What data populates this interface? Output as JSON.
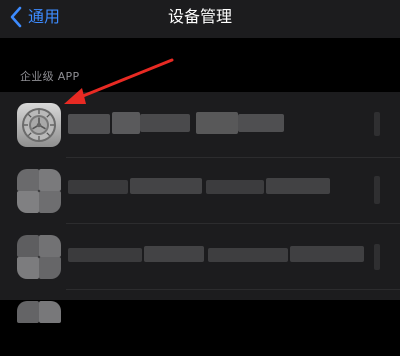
{
  "nav": {
    "back_label": "通用",
    "title": "设备管理"
  },
  "section": {
    "header": "企业级 APP"
  },
  "apps": [
    {
      "name": "",
      "icon": "settings-gear-icon"
    },
    {
      "name": "",
      "icon": "pixelated-app-icon"
    },
    {
      "name": "",
      "icon": "pixelated-app-icon"
    },
    {
      "name": "",
      "icon": "pixelated-app-icon"
    }
  ],
  "colors": {
    "accent": "#3d8bff",
    "background": "#000000",
    "cell": "#1c1c1e",
    "annotation_arrow": "#e82a23"
  }
}
